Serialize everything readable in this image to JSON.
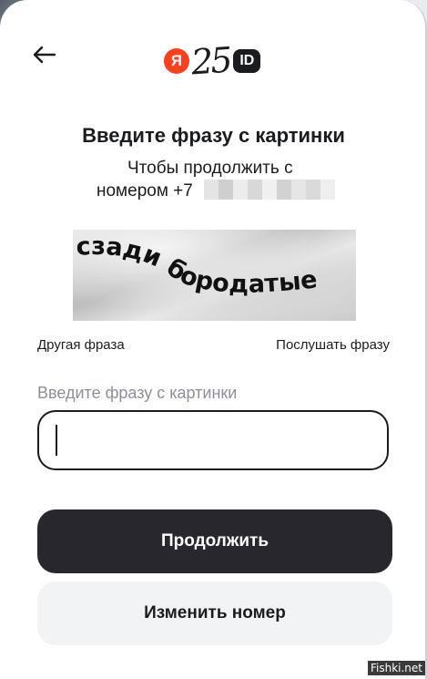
{
  "header": {
    "back_icon": "arrow-left-icon",
    "logo_mark": "Я",
    "logo_number": "25",
    "logo_badge": "ID",
    "brand_color": "#fc3f1d"
  },
  "title": "Введите фразу с картинки",
  "subtitle_line1": "Чтобы продолжить с",
  "subtitle_line2": "номером +7",
  "captcha": {
    "phrase": "сзади бородатые"
  },
  "links": {
    "another_phrase": "Другая фраза",
    "listen_phrase": "Послушать фразу"
  },
  "input": {
    "label": "Введите фразу с картинки",
    "value": ""
  },
  "buttons": {
    "continue": "Продолжить",
    "change_number": "Изменить номер"
  },
  "watermark": "Fishki.net"
}
